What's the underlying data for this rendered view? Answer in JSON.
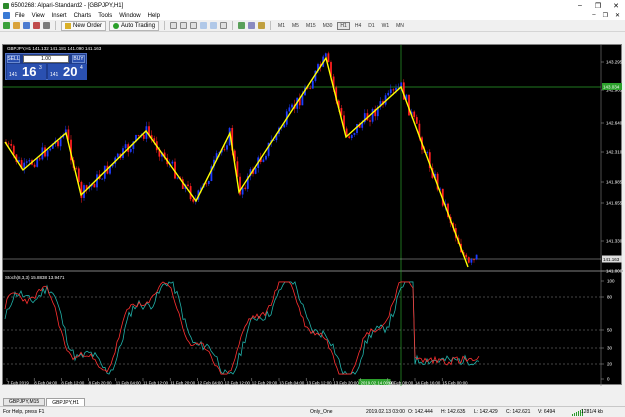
{
  "window": {
    "title": "6500268: Alpari-Standard2 - [GBPJPY,H1]",
    "controls": [
      "–",
      "❐",
      "✕"
    ]
  },
  "menu": {
    "items": [
      "File",
      "View",
      "Insert",
      "Charts",
      "Tools",
      "Window",
      "Help"
    ],
    "right_controls": [
      "–",
      "❐",
      "✕"
    ]
  },
  "toolbar": {
    "new_order": "New Order",
    "auto_trading": "Auto Trading",
    "timeframes": [
      "M1",
      "M5",
      "M15",
      "M30",
      "H1",
      "H4",
      "D1",
      "W1",
      "MN"
    ],
    "active_timeframe": "H1"
  },
  "chart": {
    "symbol_label": "GBPJPY,H1  141.132 141.181 141.090 141.163",
    "current_price_label": "143.034",
    "bid_price_label": "141.163",
    "price_ticks": [
      "143.295",
      "142.965",
      "142.640",
      "142.310",
      "141.985",
      "141.655",
      "141.330",
      "141.000"
    ],
    "time_ticks": [
      "7 Feb 2019",
      "8 Feb 04:00",
      "8 Feb 12:00",
      "8 Feb 20:00",
      "11 Feb 04:00",
      "11 Feb 12:00",
      "11 Feb 20:00",
      "12 Feb 04:00",
      "12 Feb 12:00",
      "12 Feb 20:00",
      "13 Feb 04:00",
      "13 Feb 12:00",
      "13 Feb 20:00",
      "2019.02.14 00:00",
      "14 Feb 08:00",
      "14 Feb 16:00",
      "15 Feb 00:00"
    ],
    "stoch_label": "Stoch(8,3,3) 15.8838 13.9471",
    "stoch_levels": [
      "100",
      "80",
      "50",
      "30",
      "20",
      "0"
    ],
    "zigzag_color": "#ffff00",
    "bull_color": "#1e3cff",
    "bear_color": "#ff1e1e",
    "crosshair_color": "#2ca02c"
  },
  "trade_panel": {
    "sell_label": "SELL",
    "buy_label": "BUY",
    "lot": "1.00",
    "sell_small": "141",
    "sell_big": "16",
    "sell_sup": "3",
    "buy_small": "141",
    "buy_big": "20",
    "buy_sup": "4"
  },
  "tabs": [
    {
      "label": "GBPJPY,M15",
      "active": false
    },
    {
      "label": "GBPJPY,H1",
      "active": true
    }
  ],
  "status": {
    "help": "For Help, press F1",
    "profile": "Only_One",
    "datetime": "2019.02.13 03:00",
    "open": "O: 142.444",
    "high": "H: 142.635",
    "low": "L: 142.429",
    "close": "C: 142.621",
    "volume": "V: 6494",
    "traffic": "1281/4 kb"
  }
}
